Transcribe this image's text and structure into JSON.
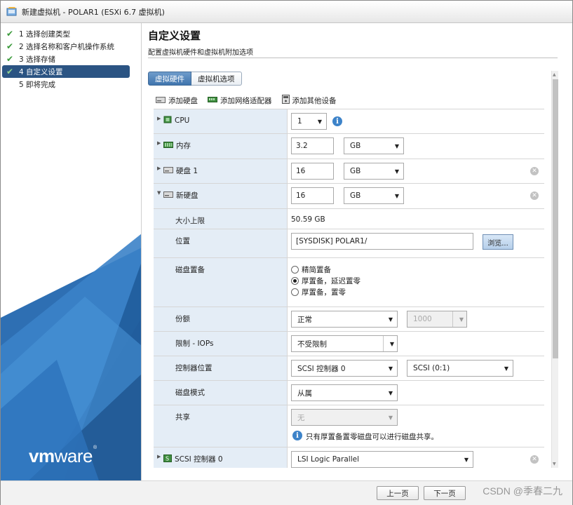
{
  "window": {
    "title": "新建虚拟机 - POLAR1 (ESXi 6.7 虚拟机)"
  },
  "steps": [
    {
      "label": "1 选择创建类型",
      "done": true
    },
    {
      "label": "2 选择名称和客户机操作系统",
      "done": true
    },
    {
      "label": "3 选择存储",
      "done": true
    },
    {
      "label": "4 自定义设置",
      "done": true,
      "active": true
    },
    {
      "label": "5 即将完成",
      "done": false
    }
  ],
  "branding": {
    "logo_vm": "vm",
    "logo_ware": "ware",
    "logo_reg": "®"
  },
  "page": {
    "title": "自定义设置",
    "subtitle": "配置虚拟机硬件和虚拟机附加选项"
  },
  "tabs": [
    {
      "label": "虚拟硬件",
      "active": true
    },
    {
      "label": "虚拟机选项",
      "active": false
    }
  ],
  "toolbar": {
    "add_disk": "添加硬盘",
    "add_nic": "添加网络适配器",
    "add_other": "添加其他设备"
  },
  "hardware": {
    "cpu": {
      "label": "CPU",
      "value": "1"
    },
    "memory": {
      "label": "内存",
      "value": "3.2",
      "unit": "GB"
    },
    "disk1": {
      "label": "硬盘 1",
      "value": "16",
      "unit": "GB"
    },
    "new_disk": {
      "label": "新硬盘",
      "value": "16",
      "unit": "GB",
      "max_size": {
        "label": "大小上限",
        "value": "50.59 GB"
      },
      "location": {
        "label": "位置",
        "value": "[SYSDISK] POLAR1/",
        "browse": "浏览..."
      },
      "provisioning": {
        "label": "磁盘置备",
        "options": [
          {
            "label": "精简置备",
            "selected": false
          },
          {
            "label": "厚置备，延迟置零",
            "selected": true
          },
          {
            "label": "厚置备，置零",
            "selected": false
          }
        ]
      },
      "shares": {
        "label": "份额",
        "value": "正常",
        "number": "1000"
      },
      "limit_iops": {
        "label": "限制 - IOPs",
        "value": "不受限制"
      },
      "controller_location": {
        "label": "控制器位置",
        "controller": "SCSI 控制器 0",
        "slot": "SCSI (0:1)"
      },
      "disk_mode": {
        "label": "磁盘模式",
        "value": "从属"
      },
      "sharing": {
        "label": "共享",
        "value": "无",
        "note": "只有厚置备置零磁盘可以进行磁盘共享。"
      }
    },
    "scsi": {
      "label": "SCSI 控制器 0",
      "value": "LSI Logic Parallel"
    }
  },
  "footer": {
    "back": "上一页",
    "next": "下一页",
    "watermark": "CSDN @季春二九"
  },
  "colors": {
    "active_step_bg": "#2b5483",
    "label_column_bg": "#e4edf6",
    "tab_active": "#3f74ad",
    "check_green": "#3a9a3a",
    "info_blue": "#3d83c9"
  }
}
